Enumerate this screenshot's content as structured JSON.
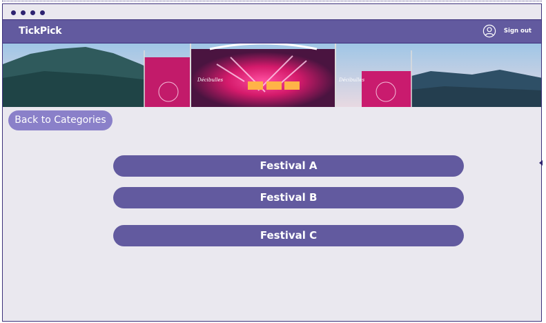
{
  "app": {
    "name": "TickPick"
  },
  "header": {
    "signout_label": "Sign out",
    "user_icon": "user-circle-icon"
  },
  "banner": {
    "image": "concert-stage-banner",
    "stage_sign_left": "Décibulles",
    "stage_sign_right": "Décibulles"
  },
  "navigation": {
    "back_label": "Back to Categories"
  },
  "festivals": [
    {
      "label": "Festival A"
    },
    {
      "label": "Festival B"
    },
    {
      "label": "Festival C"
    }
  ],
  "colors": {
    "frame_bg": "#eae8ef",
    "header_bg": "#625a9f",
    "festival_button": "#625a9f",
    "back_button": "#8a80c9",
    "outline": "#3b2f7a"
  }
}
